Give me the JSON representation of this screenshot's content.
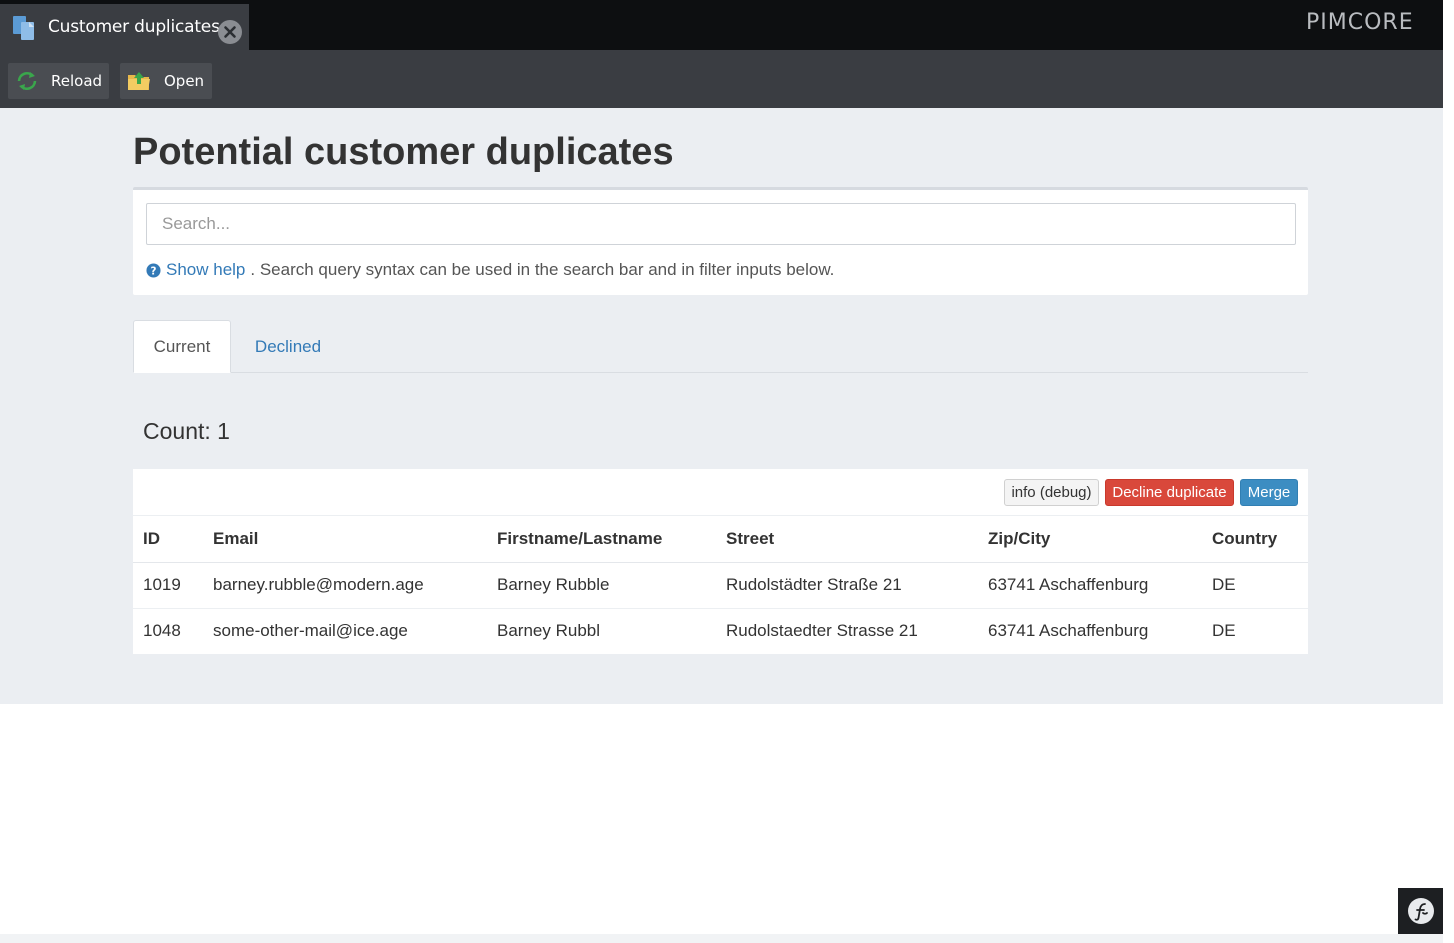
{
  "app": {
    "brand_logo": "PIMCORE",
    "tab_title": "Customer duplicates"
  },
  "toolbar": {
    "reload_label": "Reload",
    "open_label": "Open"
  },
  "page": {
    "title": "Potential customer duplicates",
    "search": {
      "placeholder": "Search...",
      "value": ""
    },
    "help": {
      "link_label": "Show help",
      "text": ". Search query syntax can be used in the search bar and in filter inputs below."
    },
    "tabs": [
      {
        "label": "Current",
        "active": true
      },
      {
        "label": "Declined",
        "active": false
      }
    ],
    "count_label": "Count: 1"
  },
  "duplicate_group": {
    "buttons": {
      "info": "info (debug)",
      "decline": "Decline duplicate",
      "merge": "Merge"
    },
    "columns": [
      "ID",
      "Email",
      "Firstname/Lastname",
      "Street",
      "Zip/City",
      "Country"
    ],
    "rows": [
      [
        "1019",
        "barney.rubble@modern.age",
        "Barney Rubble",
        "Rudolstädter Straße 21",
        "63741 Aschaffenburg",
        "DE"
      ],
      [
        "1048",
        "some-other-mail@ice.age",
        "Barney Rubbl",
        "Rudolstaedter Strasse 21",
        "63741 Aschaffenburg",
        "DE"
      ]
    ]
  },
  "colors": {
    "decline_button": "#d9483b",
    "merge_button": "#3c8dc2",
    "link": "#337ab7"
  },
  "icons": {
    "tab": "documents-icon",
    "close": "close-icon",
    "reload": "reload-icon",
    "open": "open-folder-icon",
    "help": "question-circle-icon",
    "symfony": "symfony-toolbar-icon"
  }
}
